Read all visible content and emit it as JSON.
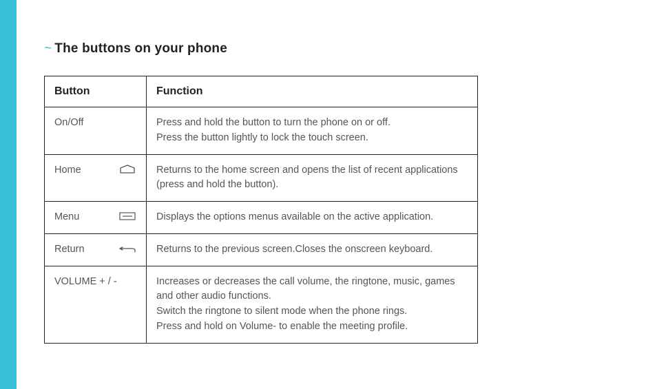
{
  "accentColor": "#37c0d6",
  "heading": "The buttons on your phone",
  "table": {
    "headers": {
      "button": "Button",
      "function": "Function"
    },
    "rows": [
      {
        "button": "On/Off",
        "icon": null,
        "functionLines": [
          "Press and hold the button to turn the phone on or off.",
          "Press the button lightly to lock the touch screen."
        ]
      },
      {
        "button": "Home",
        "icon": "home-outline-icon",
        "functionLines": [
          "Returns to the home screen and opens the list of recent applications (press and hold the button)."
        ]
      },
      {
        "button": "Menu",
        "icon": "menu-icon",
        "functionLines": [
          "Displays the options menus available on the active application."
        ]
      },
      {
        "button": "Return",
        "icon": "return-icon",
        "functionLines": [
          "Returns to the previous screen.Closes the onscreen keyboard."
        ]
      },
      {
        "button": "VOLUME + / -",
        "icon": null,
        "functionLines": [
          "Increases or decreases the call volume, the ringtone, music, games and other audio functions.",
          "Switch the ringtone to silent mode when the phone rings.",
          "Press and hold on Volume- to enable the meeting profile."
        ]
      }
    ]
  }
}
